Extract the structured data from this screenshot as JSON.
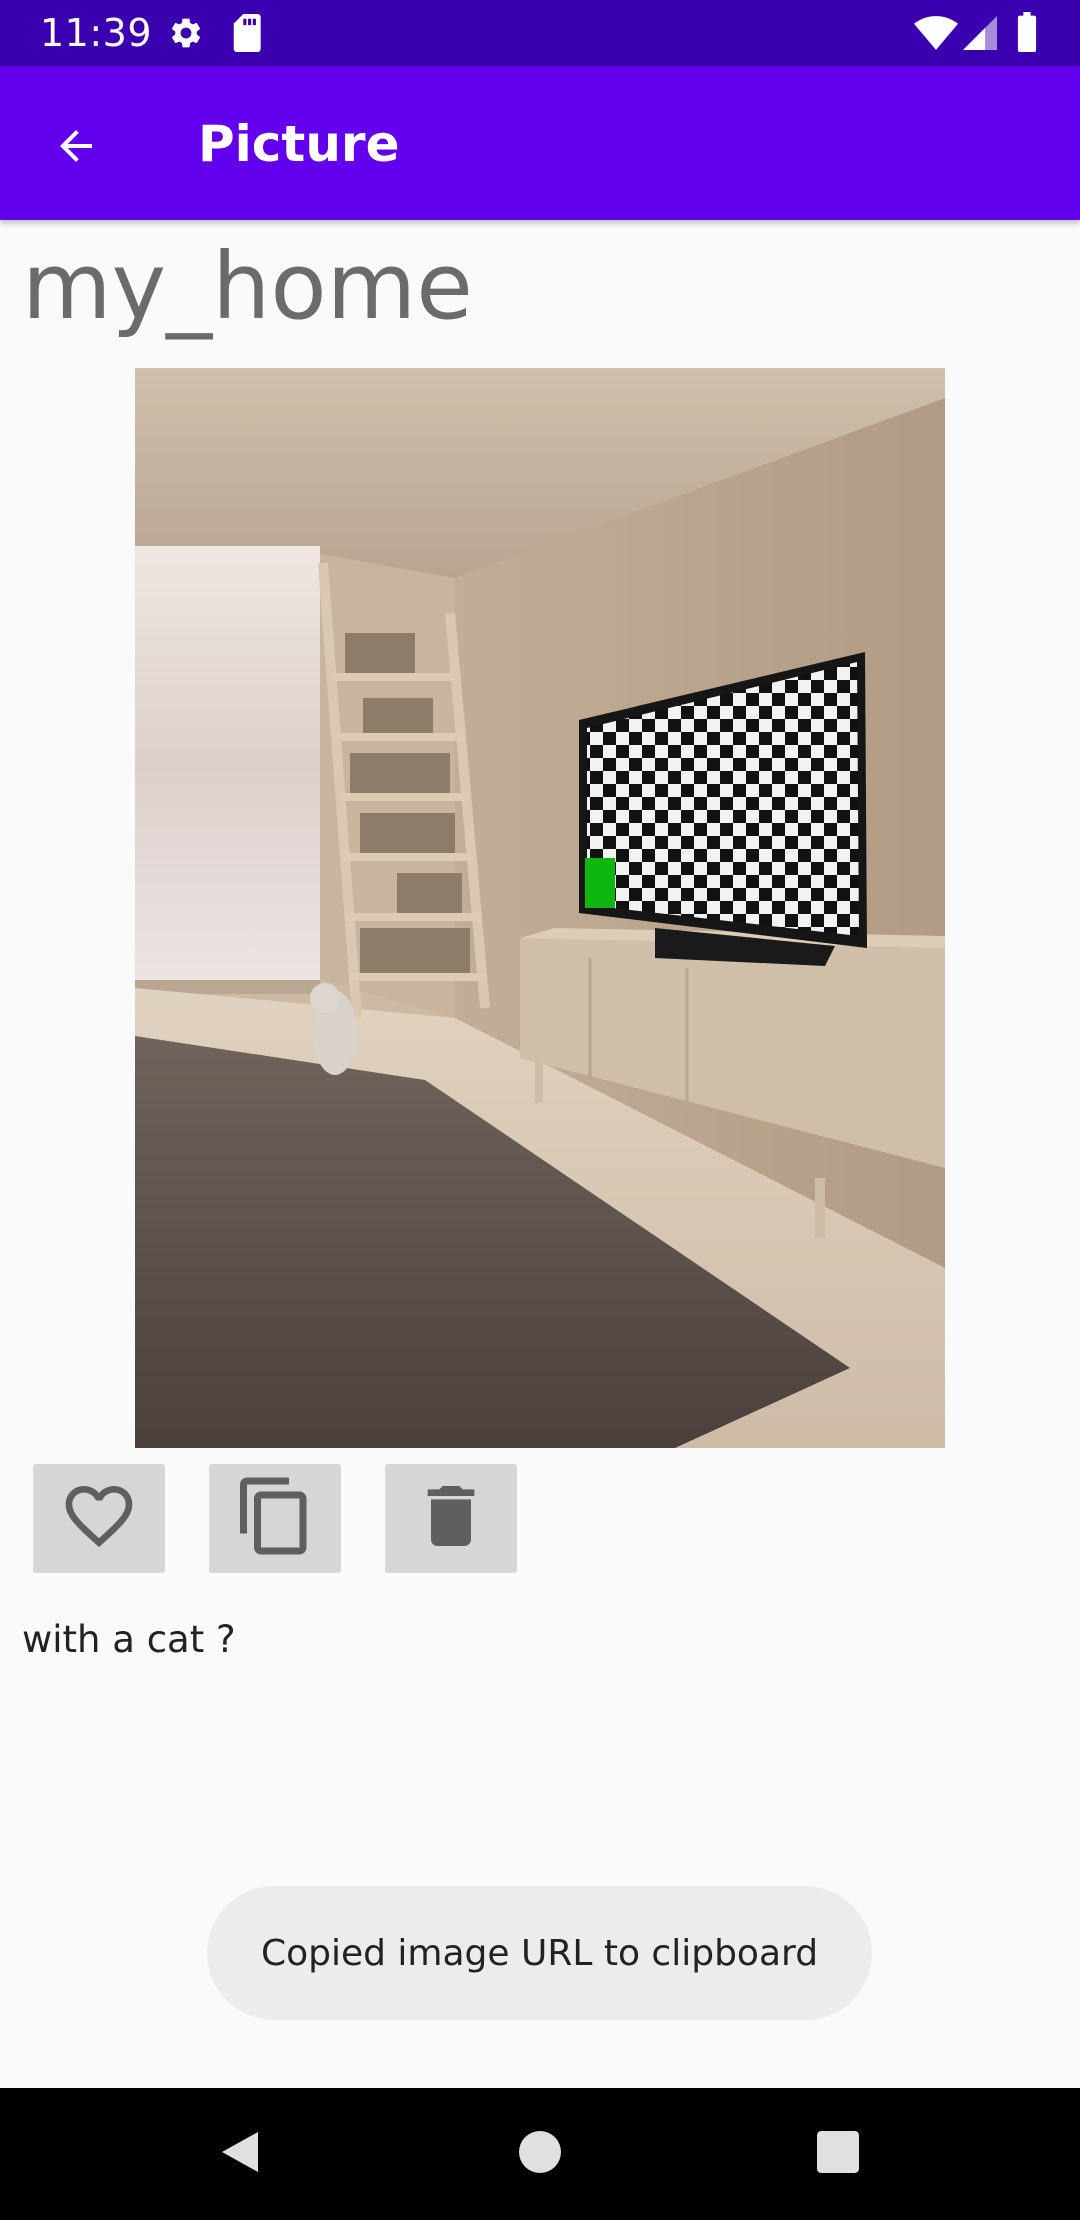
{
  "status_bar": {
    "time": "11:39",
    "icons": [
      "gear-icon",
      "sd-card-icon",
      "wifi-icon",
      "signal-icon",
      "battery-icon"
    ]
  },
  "app_bar": {
    "title": "Picture",
    "back_icon": "arrow-back-icon"
  },
  "picture": {
    "title": "my_home",
    "description": "with a cat ?"
  },
  "actions": [
    {
      "name": "favorite",
      "icon": "heart-outline-icon"
    },
    {
      "name": "copy",
      "icon": "copy-icon"
    },
    {
      "name": "delete",
      "icon": "trash-icon"
    }
  ],
  "toast": {
    "message": "Copied image URL to clipboard"
  },
  "nav_bar": {
    "icons": [
      "back-triangle-icon",
      "home-circle-icon",
      "recents-square-icon"
    ]
  },
  "colors": {
    "status_bar": "#3a00b0",
    "app_bar": "#6200ee",
    "background": "#fafafa",
    "action_button": "#d6d6d6",
    "toast": "#ececec"
  }
}
